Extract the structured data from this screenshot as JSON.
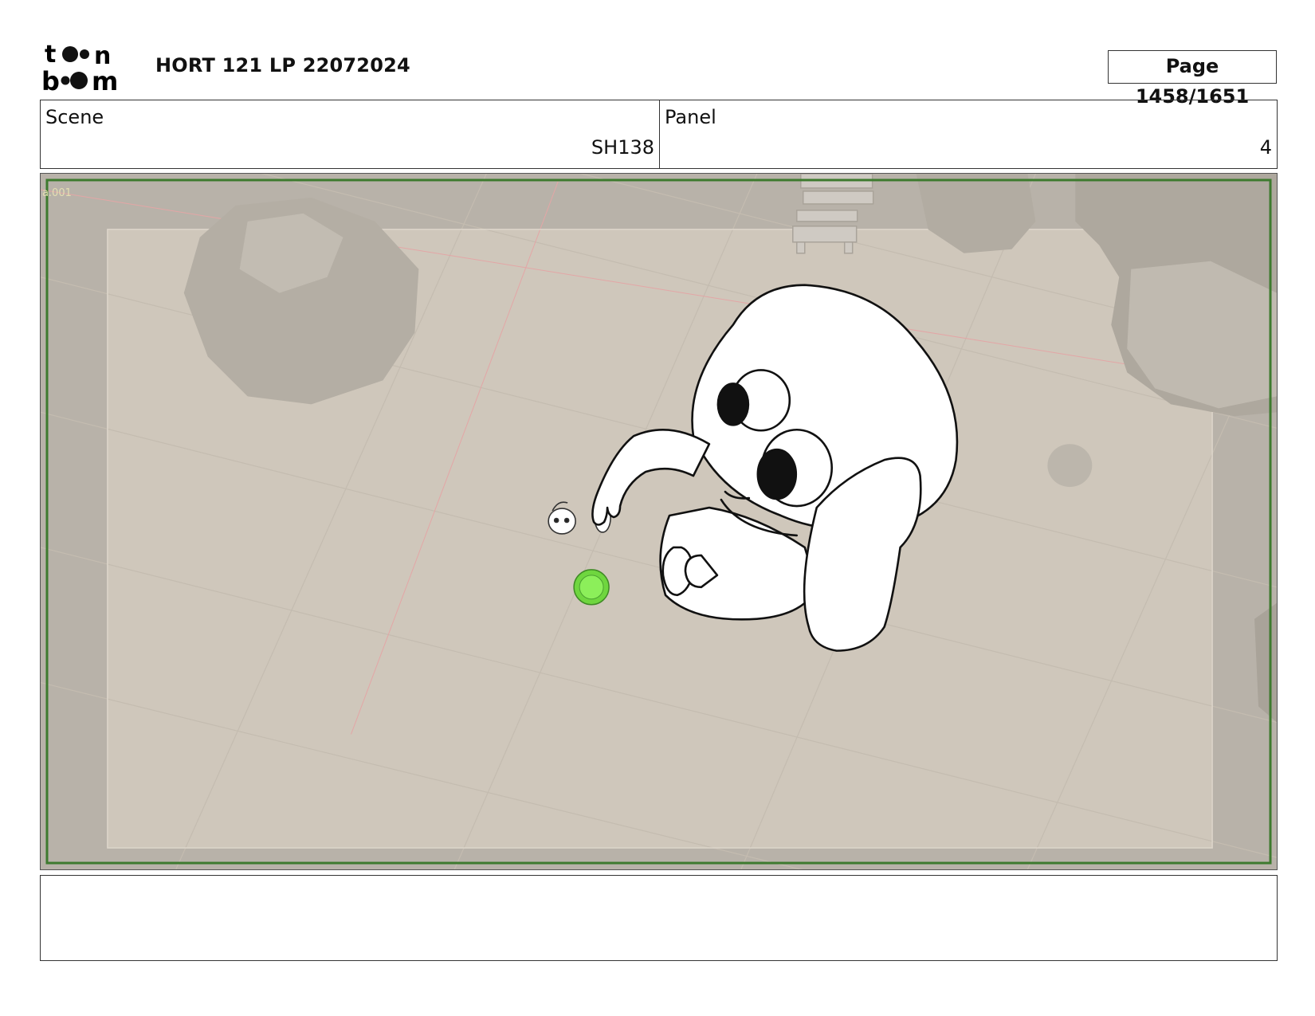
{
  "header": {
    "logo_name": "toon-boom-logo",
    "project_title": "HORT 121 LP 22072024",
    "page_label": "Page 1458/1651"
  },
  "info": {
    "scene_label": "Scene",
    "scene_value": "SH138",
    "panel_label": "Panel",
    "panel_value": "4"
  },
  "frame": {
    "camera_label": "a.001",
    "colors": {
      "floor": "#cfc7bb",
      "outer_shade": "#b6b0a7",
      "rock": "#b9b3aa",
      "safe_frame": "#3d7a2e",
      "guide_line": "#e0a0a0",
      "fruit": "#7be34a"
    }
  },
  "notes": {
    "text": ""
  }
}
